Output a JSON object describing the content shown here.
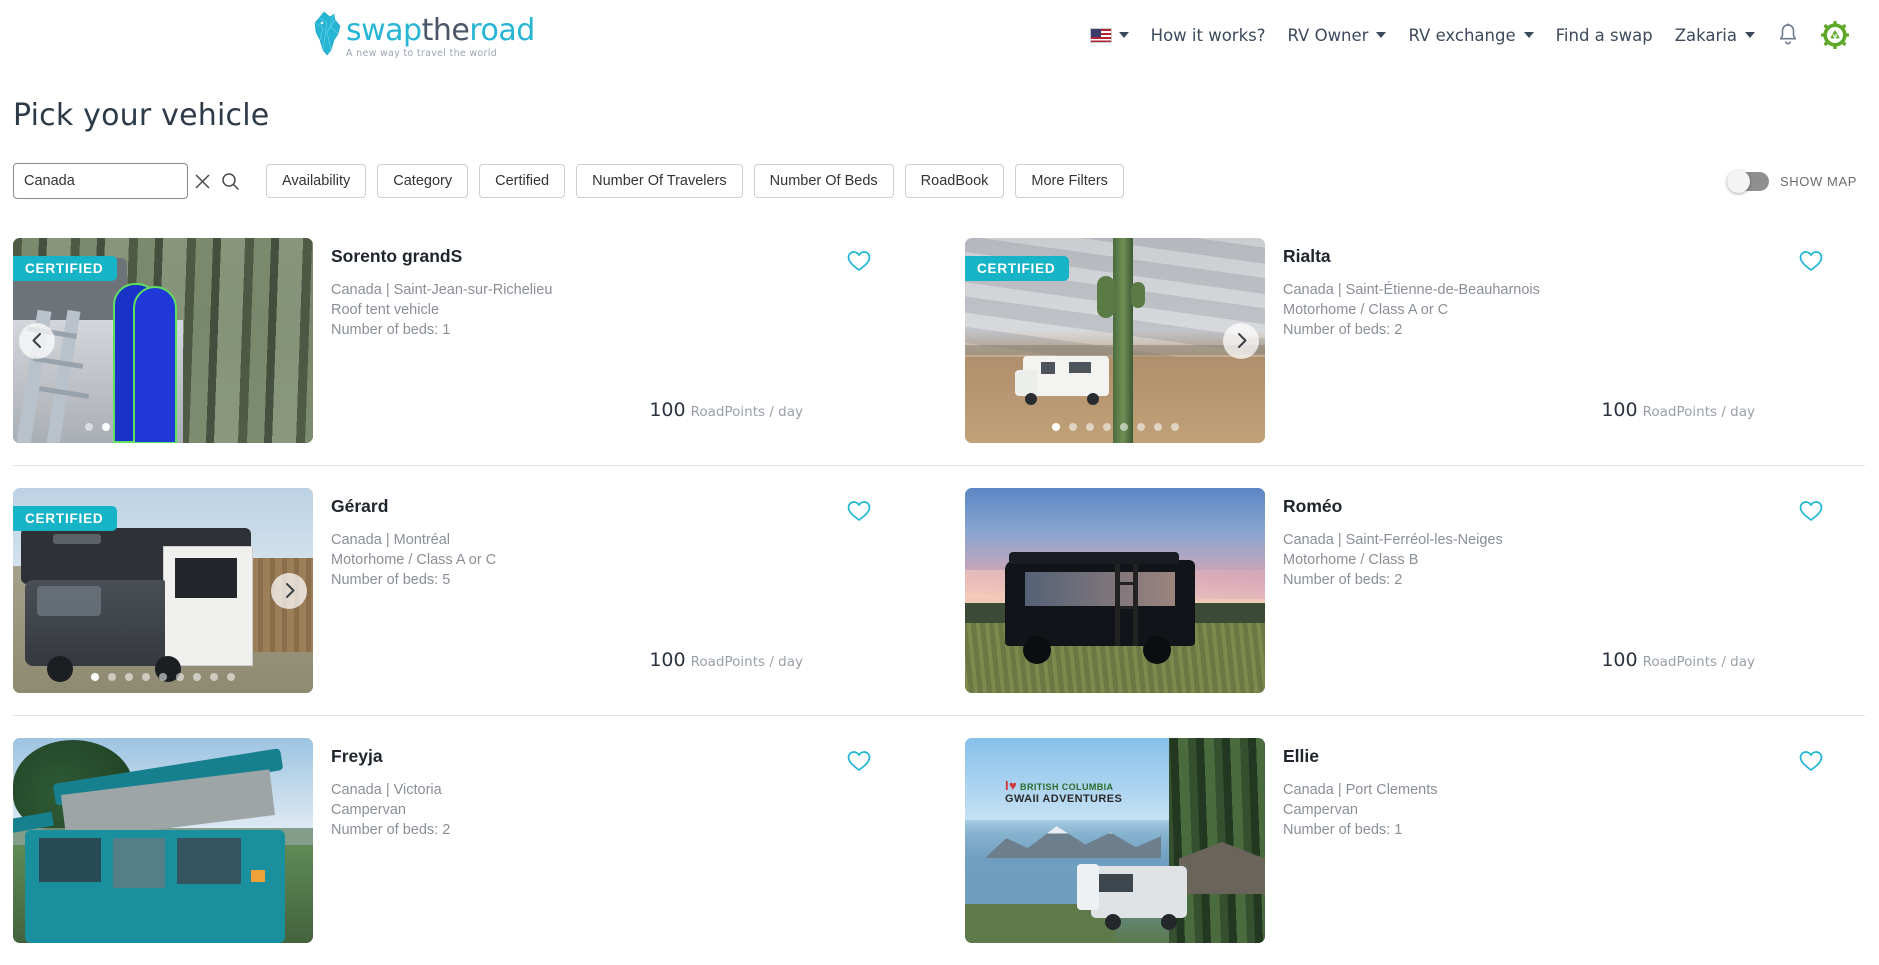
{
  "header": {
    "logo": {
      "word1": "swap",
      "word2": "the",
      "word3": "road",
      "tagline": "A new way to travel the world"
    },
    "nav": [
      {
        "label": "How it works?",
        "has_caret": false
      },
      {
        "label": "RV Owner",
        "has_caret": true
      },
      {
        "label": "RV exchange",
        "has_caret": true
      },
      {
        "label": "Find a swap",
        "has_caret": false
      },
      {
        "label": "Zakaria",
        "has_caret": true
      }
    ],
    "language_flag": "us-flag-icon",
    "notification_icon": "bell-icon",
    "account_icon": "green-gear-recycle-icon"
  },
  "page": {
    "title": "Pick your vehicle"
  },
  "search": {
    "value": "Canada",
    "placeholder": "Search",
    "clear_icon": "close-icon",
    "search_icon": "search-icon"
  },
  "filters": [
    "Availability",
    "Category",
    "Certified",
    "Number Of Travelers",
    "Number Of Beds",
    "RoadBook",
    "More Filters"
  ],
  "map_toggle": {
    "label": "SHOW MAP",
    "enabled": false
  },
  "colors": {
    "accent_teal": "#17b3c6",
    "logo_teal": "#27b5d6",
    "text_dark": "#20262e",
    "text_muted": "#8a8f96",
    "gear_green": "#5fa829"
  },
  "price_unit": "RoadPoints / day",
  "badge_label": "CERTIFIED",
  "listings": [
    {
      "name": "Sorento grandS",
      "location": "Canada | Saint-Jean-sur-Richelieu",
      "type": "Roof tent vehicle",
      "beds": "Number of beds: 1",
      "price": "100",
      "certified": true,
      "dots": 2,
      "active_dot": 1,
      "arrow": "prev",
      "favorited": false
    },
    {
      "name": "Rialta",
      "location": "Canada | Saint-Étienne-de-Beauharnois",
      "type": "Motorhome / Class A or C",
      "beds": "Number of beds: 2",
      "price": "100",
      "certified": true,
      "dots": 8,
      "active_dot": 0,
      "arrow": "next",
      "favorited": false
    },
    {
      "name": "Gérard",
      "location": "Canada | Montréal",
      "type": "Motorhome / Class A or C",
      "beds": "Number of beds: 5",
      "price": "100",
      "certified": true,
      "dots": 9,
      "active_dot": 0,
      "arrow": "next",
      "favorited": false
    },
    {
      "name": "Roméo",
      "location": "Canada | Saint-Ferréol-les-Neiges",
      "type": "Motorhome / Class B",
      "beds": "Number of beds: 2",
      "price": "100",
      "certified": false,
      "dots": 0,
      "active_dot": -1,
      "arrow": "none",
      "favorited": false
    },
    {
      "name": "Freyja",
      "location": "Canada | Victoria",
      "type": "Campervan",
      "beds": "Number of beds: 2",
      "price": "",
      "certified": false,
      "dots": 0,
      "active_dot": -1,
      "arrow": "none",
      "favorited": false
    },
    {
      "name": "Ellie",
      "location": "Canada | Port Clements",
      "type": "Campervan",
      "beds": "Number of beds: 1",
      "price": "",
      "certified": false,
      "dots": 0,
      "active_dot": -1,
      "arrow": "none",
      "favorited": false,
      "photo_overlay": "I ♥ BRITISH COLUMBIA GWAII ADVENTURES"
    }
  ]
}
